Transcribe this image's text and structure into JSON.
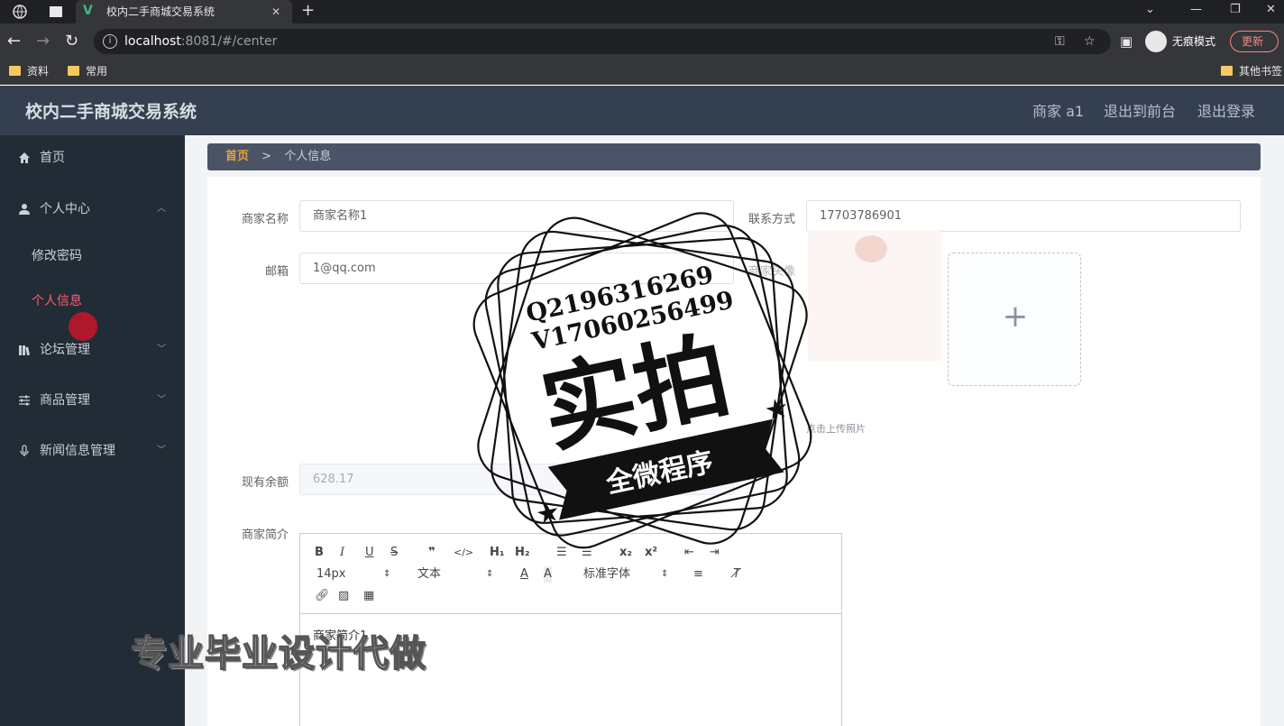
{
  "browser": {
    "tab_title": "校内二手商城交易系统",
    "url_host": "localhost",
    "url_rest": ":8081/#/center",
    "incognito_label": "无痕模式",
    "update_label": "更新",
    "bookmarks": [
      "资料",
      "常用"
    ],
    "other_bookmarks": "其他书签"
  },
  "app": {
    "title": "校内二手商城交易系统",
    "user": "商家 a1",
    "to_front": "退出到前台",
    "logout": "退出登录"
  },
  "sidebar": {
    "items": [
      {
        "label": "首页",
        "icon": "home-icon"
      },
      {
        "label": "个人中心",
        "icon": "user-icon"
      },
      {
        "label": "论坛管理",
        "icon": "forum-icon"
      },
      {
        "label": "商品管理",
        "icon": "sliders-icon"
      },
      {
        "label": "新闻信息管理",
        "icon": "mic-icon"
      }
    ],
    "sub_items": [
      "修改密码",
      "个人信息"
    ]
  },
  "breadcrumb": {
    "home": "首页",
    "sep": ">",
    "current": "个人信息"
  },
  "form": {
    "merchant_name_label": "商家名称",
    "merchant_name_value": "商家名称1",
    "contact_label": "联系方式",
    "contact_value": "17703786901",
    "email_label": "邮箱",
    "email_value": "1@qq.com",
    "avatar_label": "商家头像",
    "upload_tip": "点击上传照片",
    "balance_label": "现有余额",
    "balance_value": "628.17",
    "intro_label": "商家简介",
    "intro_value": "商家简介1"
  },
  "editor": {
    "font_size": "14px",
    "paragraph": "文本",
    "font_family": "标准字体"
  },
  "watermark": {
    "line1": "Q2196316269",
    "line2": "V17060256499",
    "big": "实拍",
    "banner": "全微程序",
    "overlay": "专业毕业设计代做"
  }
}
